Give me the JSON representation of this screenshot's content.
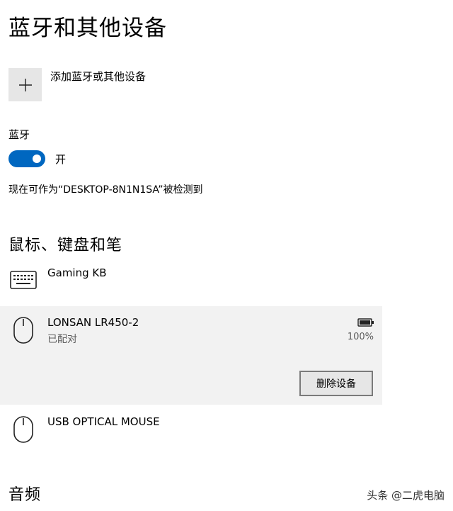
{
  "page": {
    "title": "蓝牙和其他设备"
  },
  "add_device": {
    "label": "添加蓝牙或其他设备",
    "icon": "plus-icon"
  },
  "bluetooth": {
    "heading": "蓝牙",
    "toggle_state": "开",
    "enabled": true,
    "discoverable_text": "现在可作为“DESKTOP-8N1N1SA”被检测到",
    "accent_color": "#0067c0"
  },
  "input_section": {
    "title": "鼠标、键盘和笔",
    "devices": [
      {
        "name": "Gaming KB",
        "icon": "keyboard-icon"
      },
      {
        "name": "LONSAN LR450-2",
        "status": "已配对",
        "battery": "100%",
        "battery_level": 1.0,
        "icon": "mouse-icon",
        "selected": true,
        "remove_label": "删除设备"
      },
      {
        "name": "USB OPTICAL MOUSE",
        "icon": "mouse-icon"
      }
    ]
  },
  "audio_section": {
    "title": "音频"
  },
  "watermark": {
    "text": "头条 @二虎电脑"
  }
}
